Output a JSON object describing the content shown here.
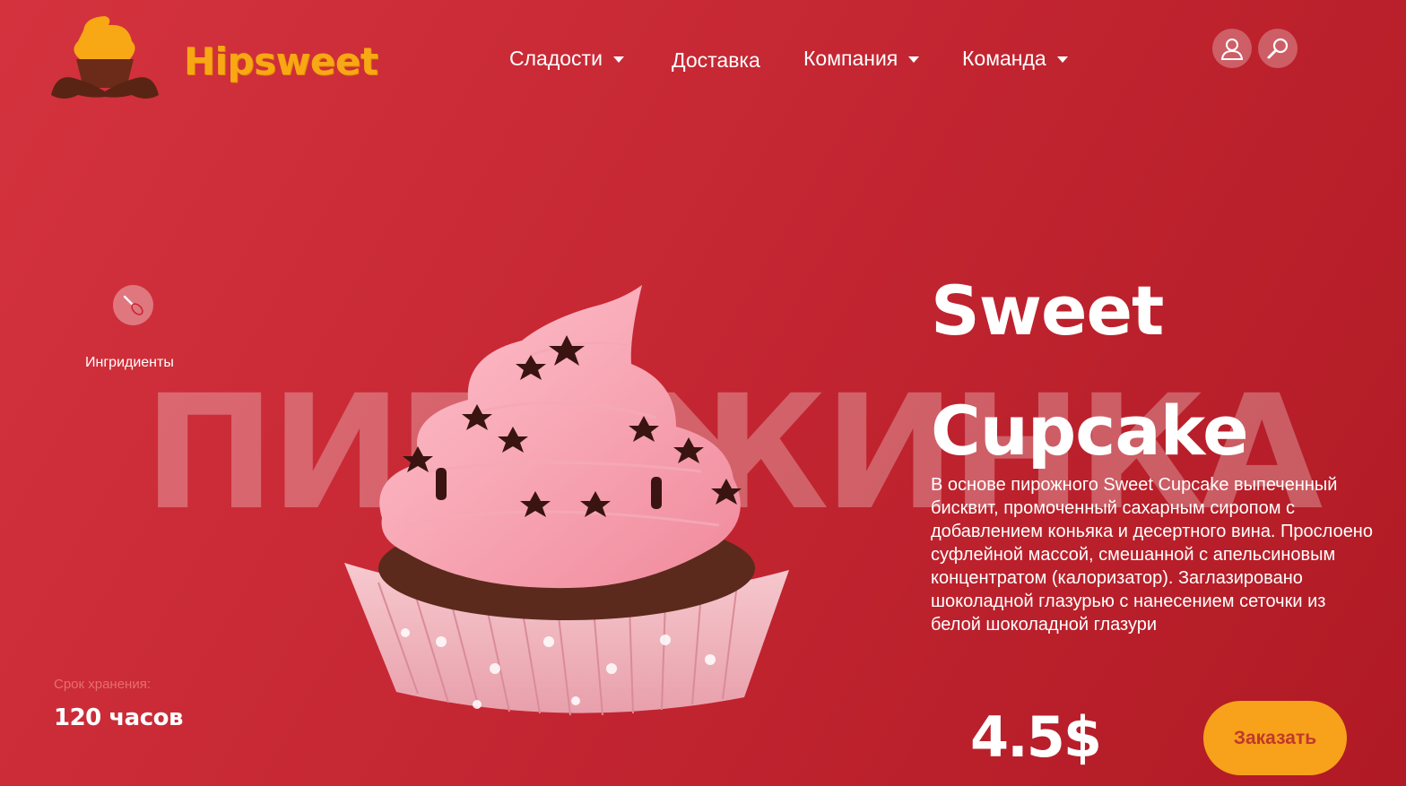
{
  "brand": {
    "name": "Hipsweet",
    "logo_icon": "cupcake-mustache-logo",
    "color": "#f8a814"
  },
  "nav": {
    "items": [
      {
        "label": "Сладости",
        "has_dropdown": true
      },
      {
        "label": "Доставка",
        "has_dropdown": false
      },
      {
        "label": "Компания",
        "has_dropdown": true
      },
      {
        "label": "Команда",
        "has_dropdown": true
      }
    ]
  },
  "header_icons": {
    "user": "user-icon",
    "search": "search-icon"
  },
  "hero": {
    "watermark": "ПИРОЖИНКА",
    "ingredients_label": "Ингридиенты",
    "ingredients_icon": "whisk-icon",
    "shelf_life_label": "Срок хранения:",
    "shelf_life_value": "120 часов",
    "title_line1": "Sweet",
    "title_line2": "Cupcake",
    "description": "В основе пирожного Sweet Cupcake выпеченный бисквит, промоченный сахарным сиропом с добавлением коньяка и десертного вина. Прослоено суфлейной массой, смешанной с апельсиновым концентратом (калоризатор). Заглазировано шоколадной глазурью с нанесением сеточки из белой шоколадной глазури",
    "price": "4.5$",
    "order_button": "Заказать"
  },
  "colors": {
    "background": "#c52733",
    "accent": "#f7a21a",
    "order_text": "#c0392b"
  }
}
